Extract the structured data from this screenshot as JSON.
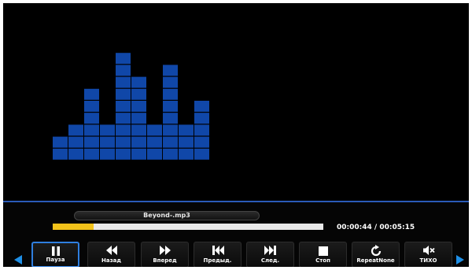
{
  "visualizer": {
    "color": "#1047a8",
    "gap_color": "#000000",
    "column_levels": [
      2,
      3,
      6,
      3,
      9,
      7,
      3,
      8,
      3,
      5
    ]
  },
  "player": {
    "track_title": "Beyond-.mp3",
    "progress_percent": 15,
    "progress_color": "#f2c21a",
    "time": "00:00:44 / 00:05:15"
  },
  "controls": {
    "scroll_left_icon": "triangle-left-icon",
    "scroll_right_icon": "triangle-right-icon",
    "buttons": [
      {
        "label": "Пауза",
        "icon": "pause-icon",
        "active": true
      },
      {
        "label": "Назад",
        "icon": "rewind-icon",
        "active": false
      },
      {
        "label": "Вперед",
        "icon": "fast-forward-icon",
        "active": false
      },
      {
        "label": "Предыд.",
        "icon": "previous-track-icon",
        "active": false
      },
      {
        "label": "След.",
        "icon": "next-track-icon",
        "active": false
      },
      {
        "label": "Стоп",
        "icon": "stop-icon",
        "active": false
      },
      {
        "label": "RepeatNone",
        "icon": "repeat-icon",
        "active": false
      },
      {
        "label": "ТИХО",
        "icon": "mute-icon",
        "active": false
      }
    ]
  }
}
